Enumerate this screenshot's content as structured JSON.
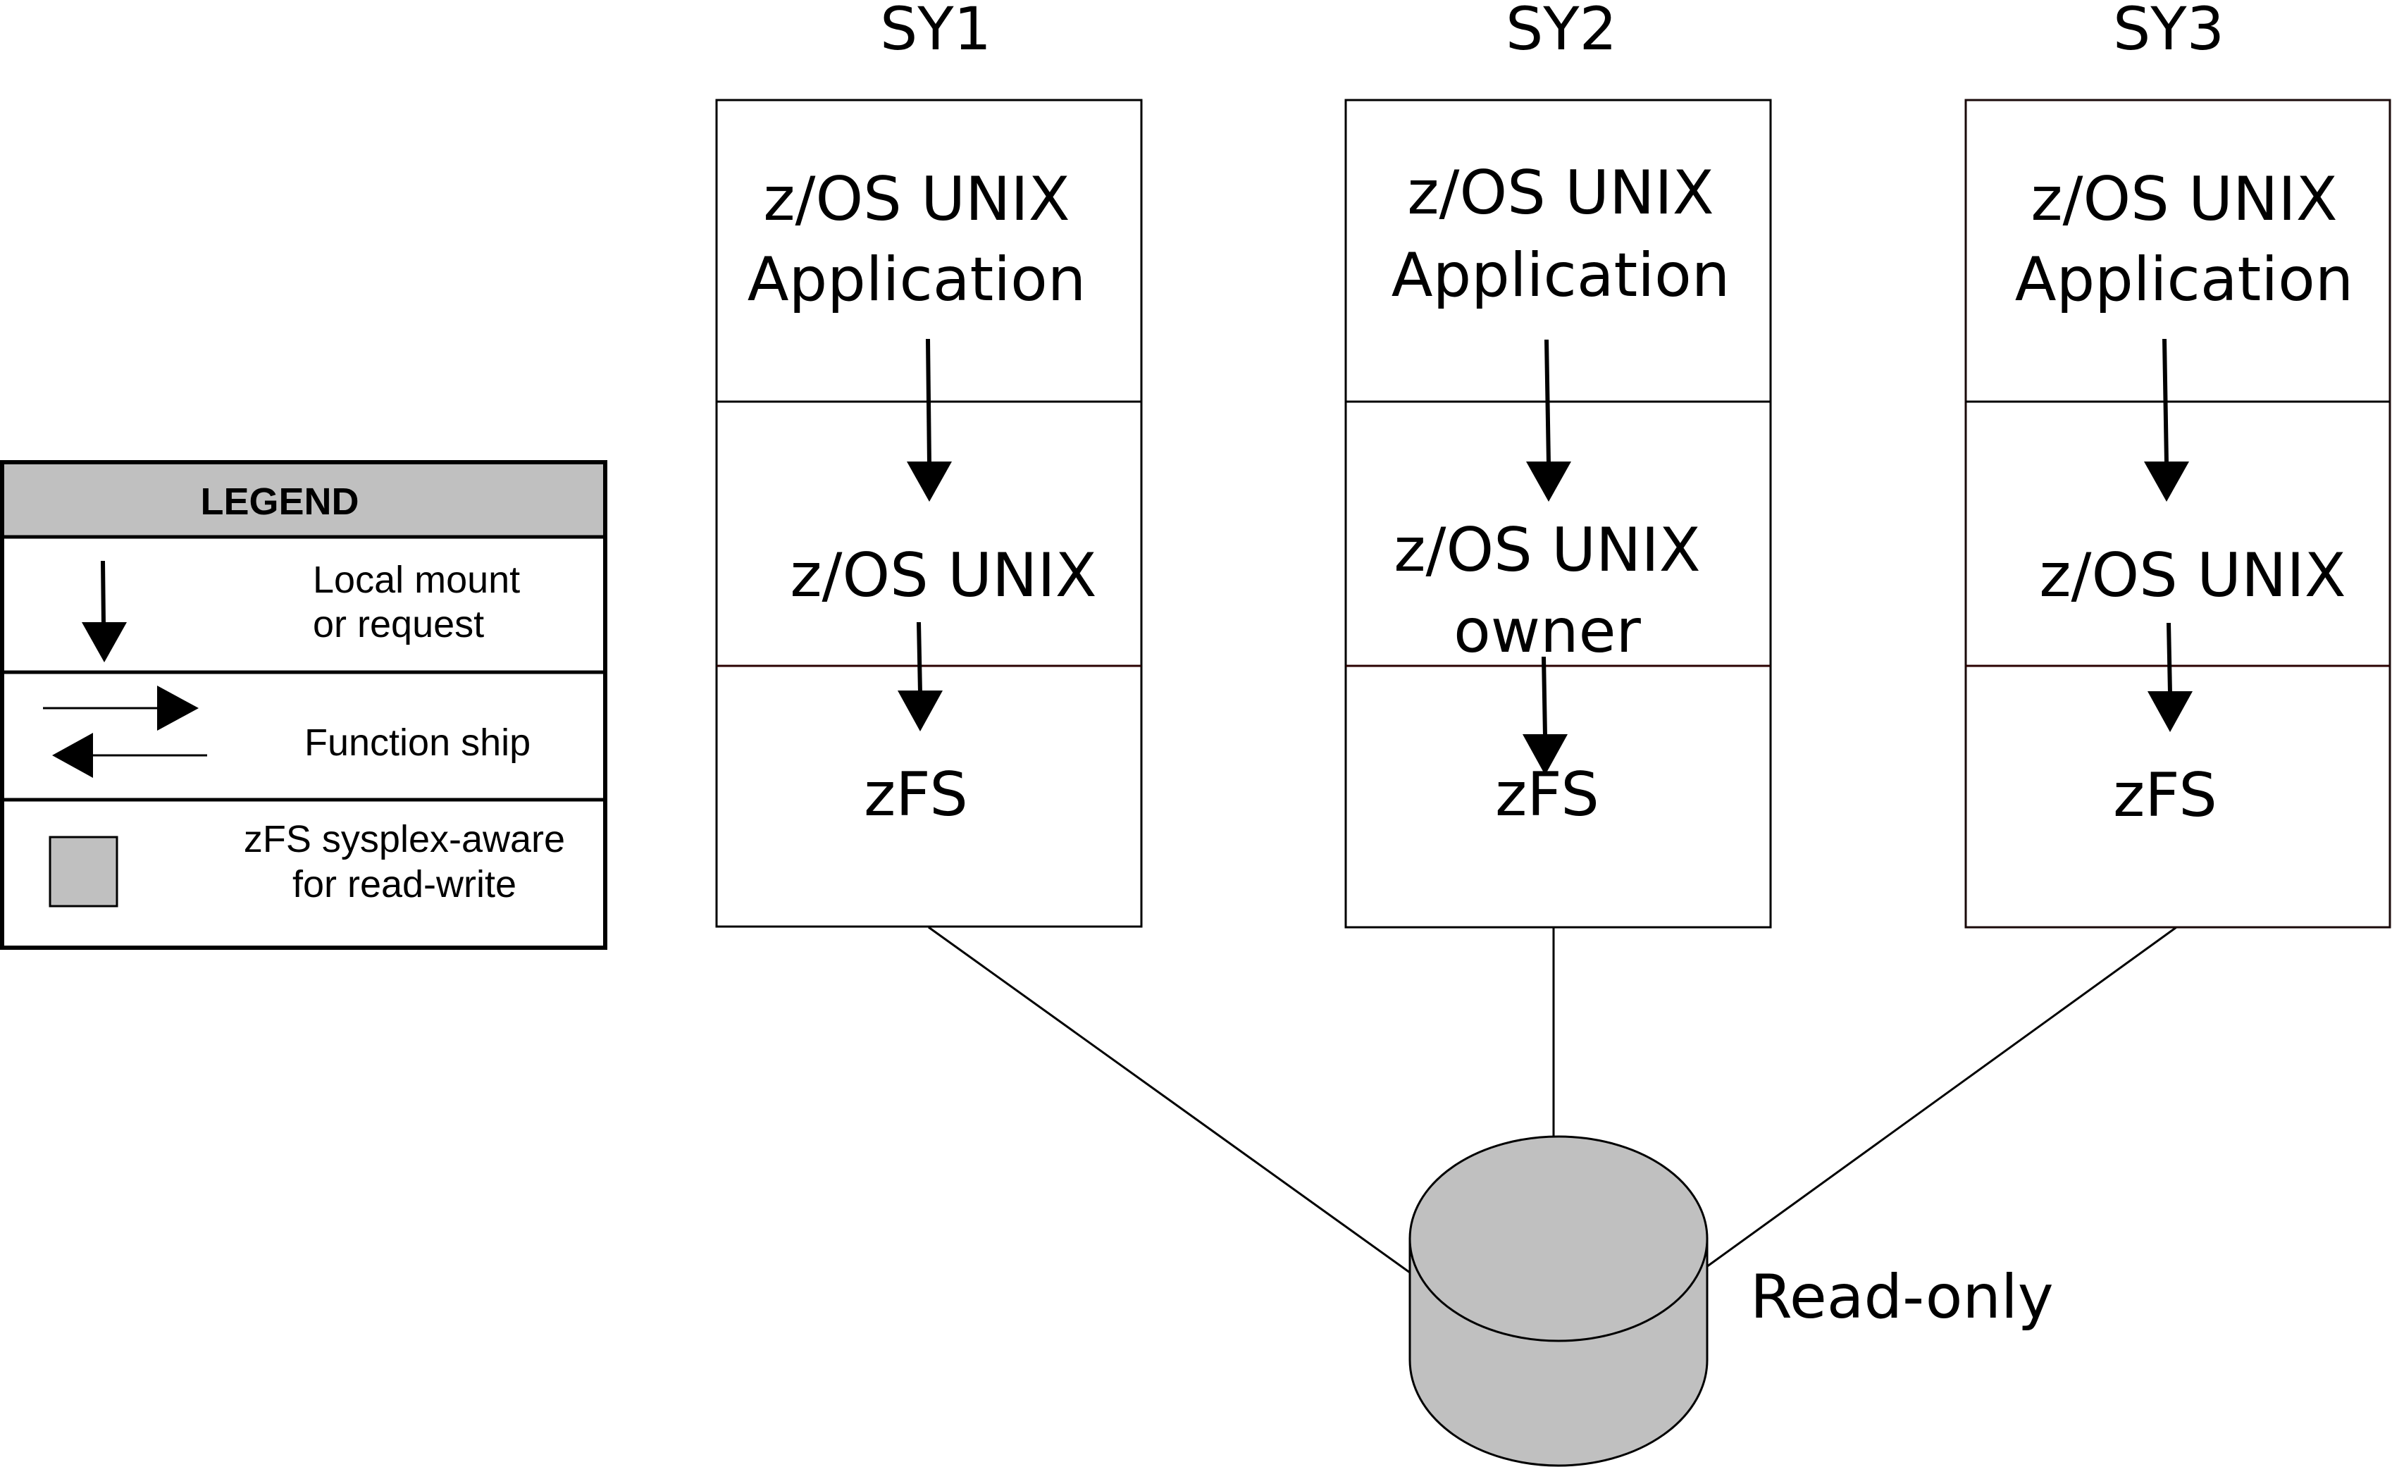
{
  "legend": {
    "title": "LEGEND",
    "items": [
      {
        "icon": "down-arrow-icon",
        "lines": [
          "Local mount",
          "or request"
        ]
      },
      {
        "icon": "bidirectional-arrows-icon",
        "lines": [
          "Function ship"
        ]
      },
      {
        "icon": "gray-square-icon",
        "lines": [
          "zFS sysplex-aware",
          "for read-write"
        ]
      }
    ],
    "header_color": "#c0c0c0",
    "swatch_color": "#c0c0c0"
  },
  "systems": [
    {
      "name": "SY1",
      "app_lines": [
        "z/OS UNIX",
        "Application"
      ],
      "middle_lines": [
        "z/OS UNIX"
      ],
      "bottom_label": "zFS"
    },
    {
      "name": "SY2",
      "app_lines": [
        "z/OS UNIX",
        "Application"
      ],
      "middle_lines": [
        "z/OS UNIX",
        "owner"
      ],
      "bottom_label": "zFS"
    },
    {
      "name": "SY3",
      "app_lines": [
        "z/OS UNIX",
        "Application"
      ],
      "middle_lines": [
        "z/OS UNIX"
      ],
      "bottom_label": "zFS"
    }
  ],
  "disk": {
    "label": "Read-only",
    "fill_color": "#c0c0c0"
  }
}
